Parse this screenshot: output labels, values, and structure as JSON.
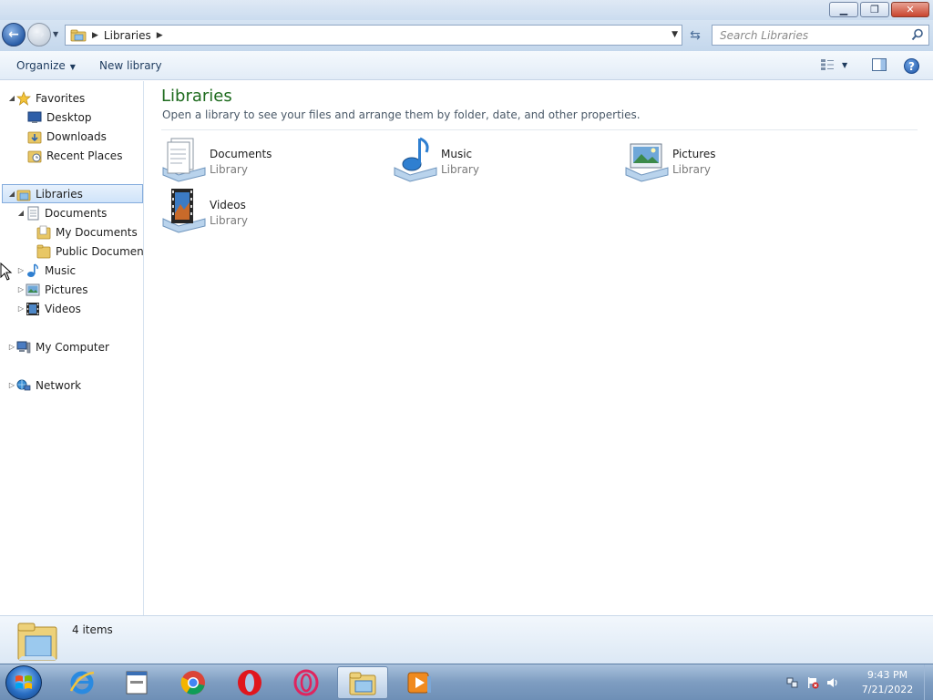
{
  "window": {
    "min_glyph": "▁",
    "max_glyph": "❐",
    "close_glyph": "✕"
  },
  "address": {
    "crumb": "Libraries",
    "search_placeholder": "Search Libraries"
  },
  "commands": {
    "organize": "Organize",
    "new_library": "New library",
    "help": "?"
  },
  "nav": {
    "favorites": "Favorites",
    "desktop": "Desktop",
    "downloads": "Downloads",
    "recent_places": "Recent Places",
    "libraries": "Libraries",
    "documents": "Documents",
    "my_documents": "My Documents",
    "public_documents": "Public Documents",
    "music": "Music",
    "pictures": "Pictures",
    "videos": "Videos",
    "my_computer": "My Computer",
    "network": "Network"
  },
  "content": {
    "title": "Libraries",
    "subtitle": "Open a library to see your files and arrange them by folder, date, and other properties.",
    "libraries": [
      {
        "name": "Documents",
        "type": "Library",
        "icon": "documents-library-icon"
      },
      {
        "name": "Music",
        "type": "Library",
        "icon": "music-library-icon"
      },
      {
        "name": "Pictures",
        "type": "Library",
        "icon": "pictures-library-icon"
      },
      {
        "name": "Videos",
        "type": "Library",
        "icon": "videos-library-icon"
      }
    ]
  },
  "details": {
    "count": "4 items"
  },
  "taskbar": {
    "apps": [
      "internet-explorer",
      "app-window",
      "chrome",
      "opera",
      "opera-gx",
      "windows-explorer",
      "media-player"
    ],
    "time": "9:43 PM",
    "date": "7/21/2022"
  },
  "colors": {
    "title_green": "#1e6b1e",
    "selection_border": "#84acdd",
    "taskbar": "#7e9dc1"
  }
}
